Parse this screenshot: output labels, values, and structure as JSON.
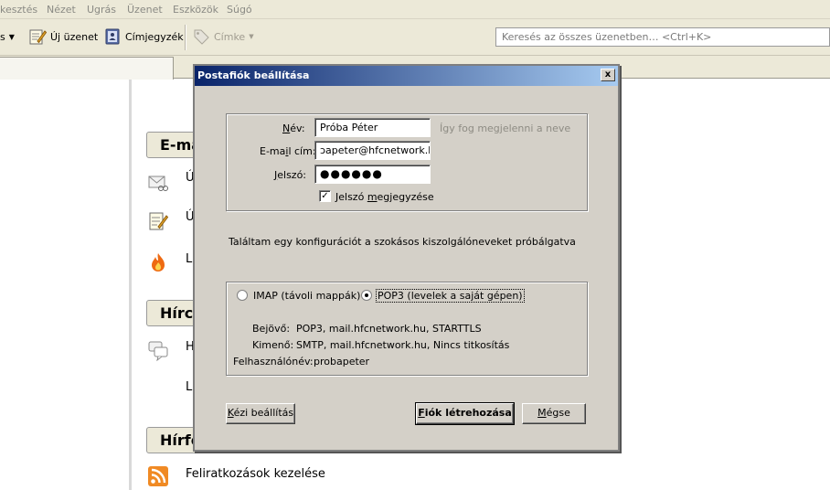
{
  "menubar": {
    "items": [
      "kesztés",
      "Nézet",
      "Ugrás",
      "Üzenet",
      "Eszközök",
      "Súgó"
    ]
  },
  "toolbar": {
    "dropdown_fragment": "s",
    "new_message": "Új üzenet",
    "address_book": "Címjegyzék",
    "tag": "Címke"
  },
  "search": {
    "placeholder": "Keresés az összes üzenetben… <Ctrl+K>"
  },
  "sections": [
    {
      "title": "E-ma"
    },
    {
      "title": "Hírcs"
    },
    {
      "title": "Hírfo"
    }
  ],
  "content_rows": [
    {
      "text": "Ú"
    },
    {
      "text": "Ú"
    },
    {
      "text": "L"
    },
    {
      "text": "H"
    },
    {
      "text": "L"
    },
    {
      "text": "Feliratkozások kezelése"
    }
  ],
  "dialog": {
    "title": "Postafiók beállítása",
    "close_label": "x",
    "name_label": "Név:",
    "name_value": "Próba Péter",
    "name_hint": "Így fog megjelenni a neve",
    "email_label": "E-mail cím:",
    "email_value": "ɔapeter@hfcnetwork.hu",
    "password_label": "Jelszó:",
    "password_value": "●●●●●●",
    "remember_label": "Jelszó megjegyzése",
    "remember_checked": true,
    "status_text": "Találtam egy konfigurációt a szokásos kiszolgálóneveket próbálgatva",
    "imap_label": "IMAP (távoli mappák)",
    "pop3_label": "POP3 (levelek a saját gépen)",
    "selected_protocol": "POP3",
    "incoming_label": "Bejövő:",
    "incoming_value": "POP3, mail.hfcnetwork.hu, STARTTLS",
    "outgoing_label": "Kimenő:",
    "outgoing_value": "SMTP, mail.hfcnetwork.hu, Nincs titkosítás",
    "username_label": "Felhasználónév:",
    "username_value": "probapeter",
    "manual_button": "Kézi beállítás",
    "create_button": "Fiók létrehozása",
    "cancel_button": "Mégse"
  },
  "colors": {
    "dialog_bg": "#d4d0c8",
    "titlebar_start": "#0a246a",
    "titlebar_end": "#a6caf0",
    "chrome_bg": "#ece9d8"
  }
}
